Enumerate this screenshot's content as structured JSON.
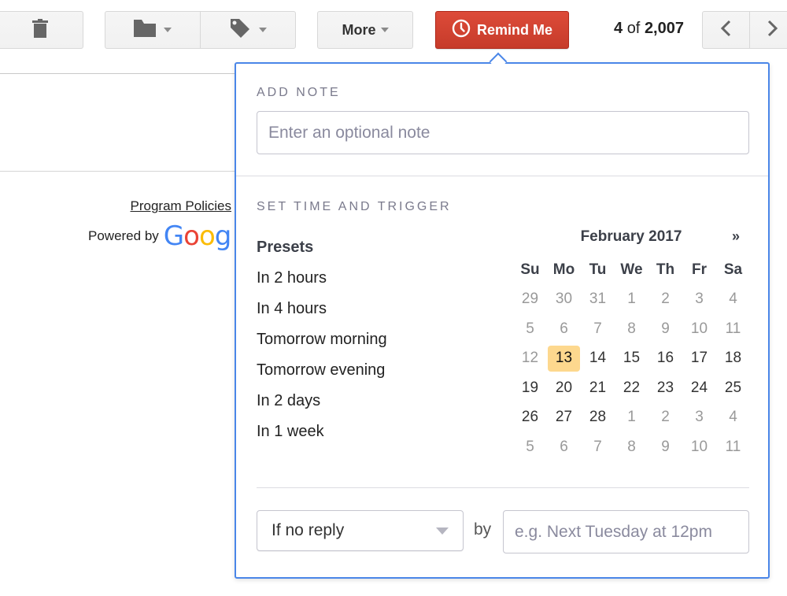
{
  "toolbar": {
    "more_label": "More",
    "remind_label": "Remind Me",
    "counter": {
      "current": "4",
      "of": "of",
      "total": "2,007"
    },
    "icons": {
      "delete": "trash-icon",
      "move": "folder-icon",
      "labels": "tag-icon",
      "remind": "clock-icon",
      "prev": "chevron-left-icon",
      "next": "chevron-right-icon"
    },
    "colors": {
      "remind_bg": "#d34836",
      "popup_border": "#4a86e8"
    }
  },
  "background_page": {
    "program_policies": "Program Policies",
    "powered_by": "Powered by",
    "google_logo": [
      "G",
      "o",
      "o",
      "g"
    ]
  },
  "popup": {
    "add_note_label": "ADD NOTE",
    "note_placeholder": "Enter an optional note",
    "set_time_label": "SET TIME AND TRIGGER",
    "presets": {
      "heading": "Presets",
      "items": [
        "In 2 hours",
        "In 4 hours",
        "Tomorrow morning",
        "Tomorrow evening",
        "In 2 days",
        "In 1 week"
      ]
    },
    "calendar": {
      "title": "February 2017",
      "next_label": "»",
      "weekdays": [
        "Su",
        "Mo",
        "Tu",
        "We",
        "Th",
        "Fr",
        "Sa"
      ],
      "weeks": [
        [
          {
            "d": "29",
            "m": true
          },
          {
            "d": "30",
            "m": true
          },
          {
            "d": "31",
            "m": true
          },
          {
            "d": "1",
            "m": true
          },
          {
            "d": "2",
            "m": true
          },
          {
            "d": "3",
            "m": true
          },
          {
            "d": "4",
            "m": true
          }
        ],
        [
          {
            "d": "5",
            "m": true
          },
          {
            "d": "6",
            "m": true
          },
          {
            "d": "7",
            "m": true
          },
          {
            "d": "8",
            "m": true
          },
          {
            "d": "9",
            "m": true
          },
          {
            "d": "10",
            "m": true
          },
          {
            "d": "11",
            "m": true
          }
        ],
        [
          {
            "d": "12",
            "m": true
          },
          {
            "d": "13",
            "s": true
          },
          {
            "d": "14"
          },
          {
            "d": "15"
          },
          {
            "d": "16"
          },
          {
            "d": "17"
          },
          {
            "d": "18"
          }
        ],
        [
          {
            "d": "19"
          },
          {
            "d": "20"
          },
          {
            "d": "21"
          },
          {
            "d": "22"
          },
          {
            "d": "23"
          },
          {
            "d": "24"
          },
          {
            "d": "25"
          }
        ],
        [
          {
            "d": "26"
          },
          {
            "d": "27"
          },
          {
            "d": "28"
          },
          {
            "d": "1",
            "m": true
          },
          {
            "d": "2",
            "m": true
          },
          {
            "d": "3",
            "m": true
          },
          {
            "d": "4",
            "m": true
          }
        ],
        [
          {
            "d": "5",
            "m": true
          },
          {
            "d": "6",
            "m": true
          },
          {
            "d": "7",
            "m": true
          },
          {
            "d": "8",
            "m": true
          },
          {
            "d": "9",
            "m": true
          },
          {
            "d": "10",
            "m": true
          },
          {
            "d": "11",
            "m": true
          }
        ]
      ],
      "selected_day": "13",
      "selected_color": "#fdd88e"
    },
    "trigger": {
      "selected": "If no reply",
      "by_label": "by",
      "time_placeholder": "e.g. Next Tuesday at 12pm"
    }
  }
}
